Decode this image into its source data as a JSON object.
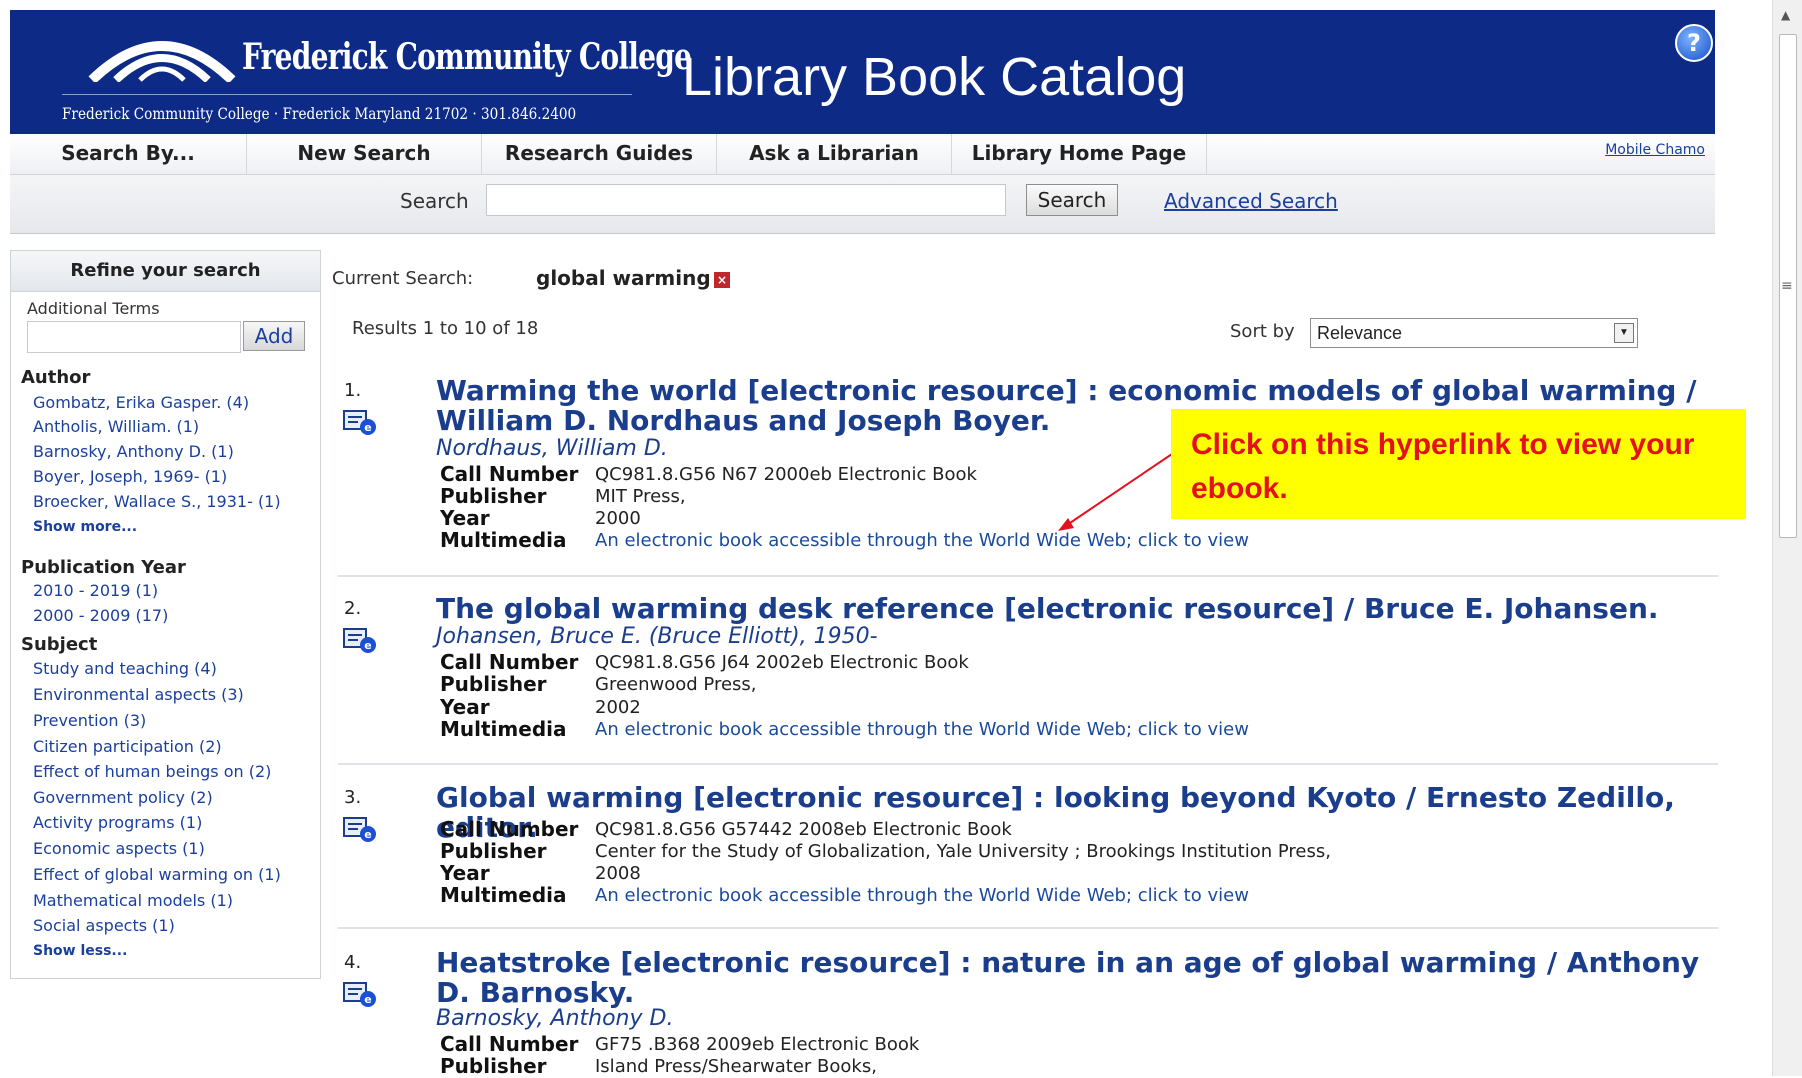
{
  "header": {
    "college_name": "Frederick Community College",
    "college_sub": "Frederick Community College · Frederick Maryland 21702 · 301.846.2400",
    "catalog_title": "Library Book Catalog",
    "help_icon": "question-mark-icon"
  },
  "nav": {
    "items": [
      "Search By...",
      "New Search",
      "Research Guides",
      "Ask a Librarian",
      "Library Home Page"
    ],
    "mobile_link": "Mobile Chamo"
  },
  "search": {
    "label": "Search",
    "value": "",
    "button": "Search",
    "advanced": "Advanced Search"
  },
  "refine": {
    "heading": "Refine your search",
    "additional_terms_label": "Additional Terms",
    "add_button": "Add",
    "author": {
      "heading": "Author",
      "items": [
        "Gombatz, Erika Gasper. (4)",
        "Antholis, William. (1)",
        "Barnosky, Anthony D. (1)",
        "Boyer, Joseph, 1969- (1)",
        "Broecker, Wallace S., 1931- (1)"
      ],
      "more": "Show more..."
    },
    "year": {
      "heading": "Publication Year",
      "items": [
        "2010 - 2019 (1)",
        "2000 - 2009 (17)"
      ]
    },
    "subject": {
      "heading": "Subject",
      "items": [
        "Study and teaching (4)",
        "Environmental aspects (3)",
        "Prevention (3)",
        "Citizen participation (2)",
        "Effect of human beings on (2)",
        "Government policy (2)",
        "Activity programs (1)",
        "Economic aspects (1)",
        "Effect of global warming on (1)",
        "Mathematical models (1)",
        "Social aspects (1)"
      ],
      "less": "Show less..."
    }
  },
  "current_search": {
    "label": "Current Search:",
    "term": "global warming",
    "remove_icon": "close-icon"
  },
  "results_count": "Results 1 to 10 of 18",
  "sort": {
    "label": "Sort by",
    "value": "Relevance"
  },
  "labels": {
    "call_number": "Call Number",
    "publisher": "Publisher",
    "year": "Year",
    "multimedia": "Multimedia"
  },
  "results": [
    {
      "num": "1.",
      "title": "Warming the world [electronic resource] : economic models of global warming / William D. Nordhaus and Joseph Boyer.",
      "author": "Nordhaus, William D.",
      "call_number": "QC981.8.G56 N67 2000eb Electronic Book",
      "publisher": "MIT Press,",
      "year": "2000",
      "multimedia": "An electronic book accessible through the World Wide Web; click to view"
    },
    {
      "num": "2.",
      "title": "The global warming desk reference [electronic resource] / Bruce E. Johansen.",
      "author": "Johansen, Bruce E. (Bruce Elliott), 1950-",
      "call_number": "QC981.8.G56 J64 2002eb Electronic Book",
      "publisher": "Greenwood Press,",
      "year": "2002",
      "multimedia": "An electronic book accessible through the World Wide Web; click to view"
    },
    {
      "num": "3.",
      "title": "Global warming [electronic resource] : looking beyond Kyoto / Ernesto Zedillo, editor.",
      "call_number": "QC981.8.G56 G57442 2008eb Electronic Book",
      "publisher": "Center for the Study of Globalization, Yale University ; Brookings Institution Press,",
      "year": "2008",
      "multimedia": "An electronic book accessible through the World Wide Web; click to view"
    },
    {
      "num": "4.",
      "title": "Heatstroke [electronic resource] : nature in an age of global warming / Anthony D. Barnosky.",
      "author": "Barnosky, Anthony D.",
      "call_number": "GF75 .B368 2009eb Electronic Book",
      "publisher": "Island Press/Shearwater Books,"
    }
  ],
  "callout": {
    "text": "Click on this hyperlink to view your ebook.",
    "color": "#e3101d",
    "background": "#ffff00"
  },
  "colors": {
    "banner": "#0c2a86",
    "link": "#1a3e8c"
  }
}
